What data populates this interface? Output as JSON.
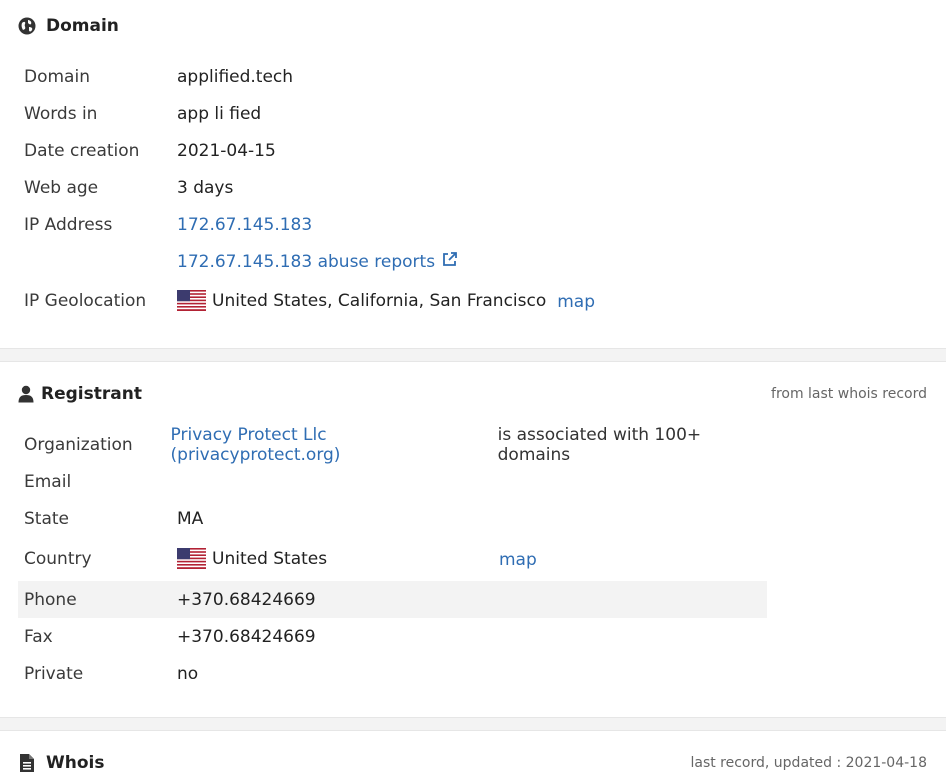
{
  "domain_section": {
    "title": "Domain",
    "rows": {
      "domain": {
        "label": "Domain",
        "value": "applified.tech"
      },
      "words": {
        "label": "Words in",
        "value": "app li fied"
      },
      "date_creation": {
        "label": "Date creation",
        "value": "2021-04-15"
      },
      "web_age": {
        "label": "Web age",
        "value": "3 days"
      },
      "ip": {
        "label": "IP Address",
        "value": "172.67.145.183",
        "abuse_link": "172.67.145.183 abuse reports"
      },
      "geo": {
        "label": "IP Geolocation",
        "value": "United States, California, San Francisco",
        "map_link": "map"
      }
    }
  },
  "registrant_section": {
    "title": "Registrant",
    "meta": "from last whois record",
    "rows": {
      "organization": {
        "label": "Organization",
        "value": "Privacy Protect Llc (privacyprotect.org)",
        "extra": "is associated with 100+ domains"
      },
      "email": {
        "label": "Email",
        "value": ""
      },
      "state": {
        "label": "State",
        "value": "MA"
      },
      "country": {
        "label": "Country",
        "value": "United States",
        "map_link": "map"
      },
      "phone": {
        "label": "Phone",
        "value": "+370.68424669"
      },
      "fax": {
        "label": "Fax",
        "value": "+370.68424669"
      },
      "private": {
        "label": "Private",
        "value": "no"
      }
    }
  },
  "whois_section": {
    "title": "Whois",
    "meta": "last record, updated : 2021-04-18"
  },
  "icons": {
    "domain": "globe-icon",
    "registrant": "user-icon",
    "whois": "document-icon",
    "external": "external-link-icon",
    "flag": "us-flag-icon"
  },
  "colors": {
    "link": "#2f6db3",
    "separator": "#f3f3f3",
    "shaded_row": "#f3f3f3"
  }
}
